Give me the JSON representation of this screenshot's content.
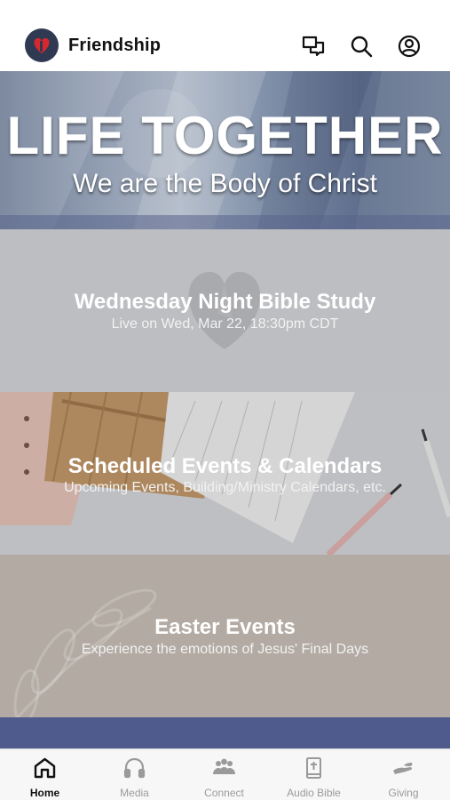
{
  "header": {
    "title": "Friendship",
    "icons": [
      "chat-icon",
      "search-icon",
      "account-icon"
    ]
  },
  "hero": {
    "title": "LIFE TOGETHER",
    "subtitle": "We are the Body of Christ"
  },
  "cards": [
    {
      "title": "Wednesday Night Bible Study",
      "subtitle": "Live on Wed, Mar 22, 18:30pm CDT"
    },
    {
      "title": "Scheduled Events & Calendars",
      "subtitle": "Upcoming Events, Building/Ministry Calendars, etc."
    },
    {
      "title": "Easter Events",
      "subtitle": "Experience the emotions of Jesus' Final Days"
    }
  ],
  "tabs": [
    {
      "label": "Home",
      "icon": "home-icon",
      "active": true
    },
    {
      "label": "Media",
      "icon": "headphones-icon",
      "active": false
    },
    {
      "label": "Connect",
      "icon": "people-icon",
      "active": false
    },
    {
      "label": "Audio Bible",
      "icon": "bible-icon",
      "active": false
    },
    {
      "label": "Giving",
      "icon": "giving-hand-icon",
      "active": false
    }
  ],
  "colors": {
    "logo_bg": "#2f3a52",
    "logo_heart": "#d8282f",
    "tab_active": "#111111",
    "tab_inactive": "#9a9a9a",
    "strip": "#4f5b8c"
  }
}
